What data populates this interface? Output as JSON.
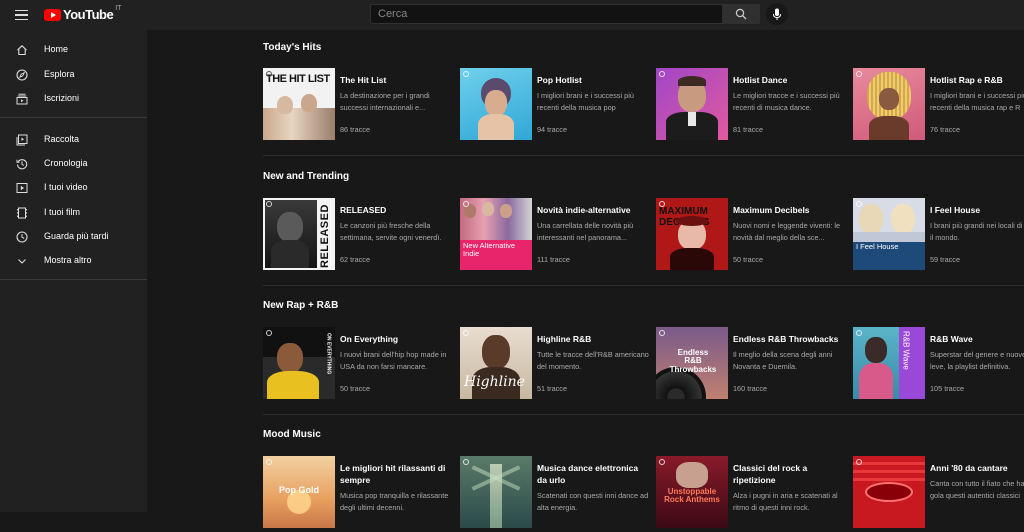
{
  "header": {
    "logo_text": "YouTube",
    "country": "IT",
    "search_placeholder": "Cerca"
  },
  "sidebar": {
    "items": [
      {
        "label": "Home",
        "icon": "home-icon"
      },
      {
        "label": "Esplora",
        "icon": "compass-icon"
      },
      {
        "label": "Iscrizioni",
        "icon": "subscriptions-icon"
      },
      {
        "label": "Raccolta",
        "icon": "library-icon"
      },
      {
        "label": "Cronologia",
        "icon": "history-icon"
      },
      {
        "label": "I tuoi video",
        "icon": "play-icon"
      },
      {
        "label": "I tuoi film",
        "icon": "film-icon"
      },
      {
        "label": "Guarda più tardi",
        "icon": "clock-icon"
      },
      {
        "label": "Mostra altro",
        "icon": "chevron-down-icon"
      }
    ]
  },
  "shelves": [
    {
      "title": "Today's Hits",
      "cards": [
        {
          "title": "The Hit List",
          "desc": "La destinazione per i grandi successi internazionali e...",
          "count": "86 tracce",
          "thumb_text": "THE HIT LIST"
        },
        {
          "title": "Pop Hotlist",
          "desc": "I migliori brani e i successi più recenti della musica pop",
          "count": "94 tracce",
          "thumb_text": ""
        },
        {
          "title": "Hotlist Dance",
          "desc": "Le migliori tracce e i successi più recenti di musica dance.",
          "count": "81 tracce",
          "thumb_text": ""
        },
        {
          "title": "Hotlist Rap e R&B",
          "desc": "I migliori brani e i successi più recenti della musica rap e R",
          "count": "76 tracce",
          "thumb_text": ""
        }
      ]
    },
    {
      "title": "New and Trending",
      "cards": [
        {
          "title": "RELEASED",
          "desc": "Le canzoni più fresche della settimana, servite ogni venerdì.",
          "count": "62 tracce",
          "thumb_text": "RELEASED"
        },
        {
          "title": "Novità indie-alternative",
          "desc": "Una carrellata delle novità più interessanti nel panorama...",
          "count": "111 tracce",
          "thumb_text": "New Alternative Indie"
        },
        {
          "title": "Maximum Decibels",
          "desc": "Nuovi nomi e leggende viventi: le novità dal meglio della sce...",
          "count": "50 tracce",
          "thumb_text": "MAXIMUM DECIBELS"
        },
        {
          "title": "I Feel House",
          "desc": "I brani più grandi nei locali di tutto il mondo.",
          "count": "59 tracce",
          "thumb_text": "I Feel House"
        }
      ]
    },
    {
      "title": "New Rap + R&B",
      "cards": [
        {
          "title": "On Everything",
          "desc": "I nuovi brani dell'hip hop made in USA da non farsi mancare.",
          "count": "50 tracce",
          "thumb_text": "ON EVERYTHING"
        },
        {
          "title": "Highline R&B",
          "desc": "Tutte le tracce dell'R&B americano del momento.",
          "count": "51 tracce",
          "thumb_text": "Highline"
        },
        {
          "title": "Endless R&B Throwbacks",
          "desc": "Il meglio della scena degli anni Novanta e Duemila.",
          "count": "160 tracce",
          "thumb_text": "Endless R&B Throwbacks"
        },
        {
          "title": "R&B Wave",
          "desc": "Superstar del genere e nuove leve, la playlist definitiva.",
          "count": "105 tracce",
          "thumb_text": "R&B Wave"
        }
      ]
    },
    {
      "title": "Mood Music",
      "cards": [
        {
          "title": "Le migliori hit rilassanti di sempre",
          "desc": "Musica pop tranquilla e rilassante degli ultimi decenni.",
          "count": "",
          "thumb_text": "Pop Gold"
        },
        {
          "title": "Musica dance elettronica da urlo",
          "desc": "Scatenati con questi inni dance ad alta energia.",
          "count": "",
          "thumb_text": ""
        },
        {
          "title": "Classici del rock a ripetizione",
          "desc": "Alza i pugni in aria e scatenati al ritmo di questi inni rock.",
          "count": "",
          "thumb_text": "Unstoppable Rock Anthems"
        },
        {
          "title": "Anni '80 da cantare",
          "desc": "Canta con tutto il fiato che hai, gola questi autentici classici",
          "count": "",
          "thumb_text": ""
        }
      ]
    }
  ]
}
